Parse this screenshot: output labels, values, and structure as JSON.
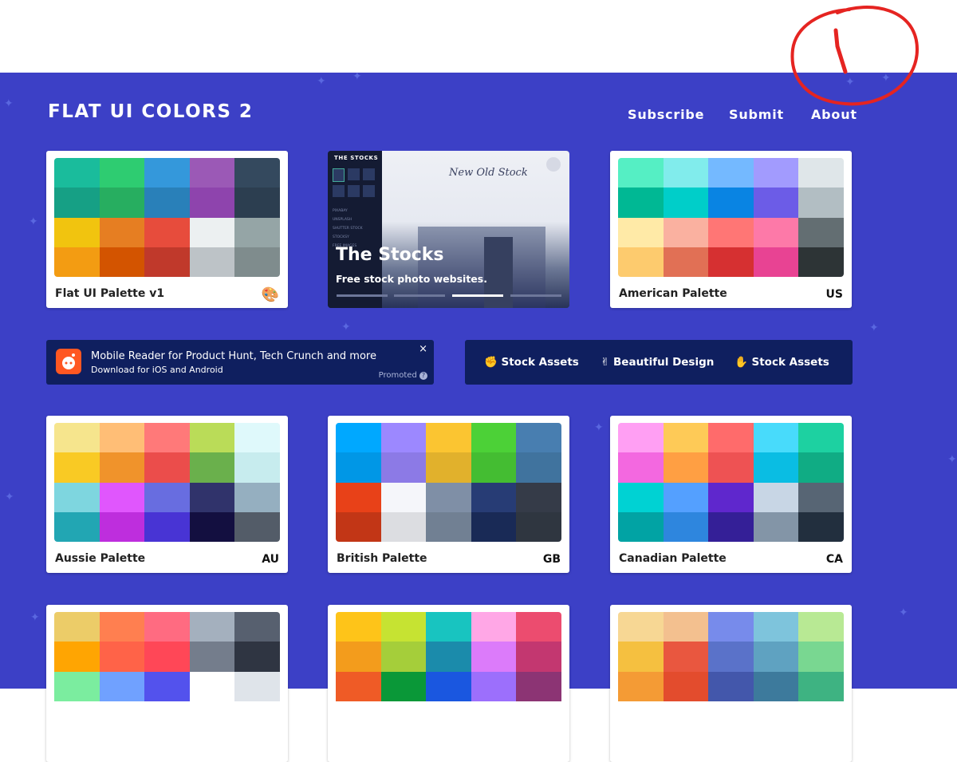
{
  "brand": {
    "title": "FLAT UI COLORS 2"
  },
  "nav": {
    "subscribe": "Subscribe",
    "submit": "Submit",
    "about": "About"
  },
  "ad": {
    "sidebar_heading": "THE STOCKS",
    "sidebar_items": [
      "PIXABAY",
      "UNSPLASH",
      "SHUTTER STOCK",
      "STOCKSY",
      "FREE IMAGES"
    ],
    "script_title": "New Old Stock",
    "title": "The Stocks",
    "subtitle": "Free stock photo websites."
  },
  "promo": {
    "title": "Mobile Reader for Product Hunt, Tech Crunch and more",
    "subtitle": "Download for iOS and Android",
    "tag": "Promoted",
    "close": "×"
  },
  "banner": {
    "item1": "✊ Stock Assets",
    "item2": "✌ Beautiful Design",
    "item3": "✋ Stock Assets"
  },
  "palettes": [
    {
      "name": "Flat UI Palette v1",
      "code": "🎨",
      "colors": [
        "#1abc9c",
        "#2ecc71",
        "#3498db",
        "#9b59b6",
        "#34495e",
        "#16a085",
        "#27ae60",
        "#2980b9",
        "#8e44ad",
        "#2c3e50",
        "#f1c40f",
        "#e67e22",
        "#e74c3c",
        "#ecf0f1",
        "#95a5a6",
        "#f39c12",
        "#d35400",
        "#c0392b",
        "#bdc3c7",
        "#7f8c8d"
      ]
    },
    {
      "name": "American Palette",
      "code": "US",
      "colors": [
        "#55efc4",
        "#81ecec",
        "#74b9ff",
        "#a29bfe",
        "#dfe6e9",
        "#00b894",
        "#00cec9",
        "#0984e3",
        "#6c5ce7",
        "#b2bec3",
        "#ffeaa7",
        "#fab1a0",
        "#ff7675",
        "#fd79a8",
        "#636e72",
        "#fdcb6e",
        "#e17055",
        "#d63031",
        "#e84393",
        "#2d3436"
      ]
    },
    {
      "name": "Aussie Palette",
      "code": "AU",
      "colors": [
        "#f6e58d",
        "#ffbe76",
        "#ff7979",
        "#badc58",
        "#dff9fb",
        "#f9ca24",
        "#f0932b",
        "#eb4d4b",
        "#6ab04c",
        "#c7ecee",
        "#7ed6df",
        "#e056fd",
        "#686de0",
        "#30336b",
        "#95afc0",
        "#22a6b3",
        "#be2edd",
        "#4834d4",
        "#130f40",
        "#535c68"
      ]
    },
    {
      "name": "British Palette",
      "code": "GB",
      "colors": [
        "#00a8ff",
        "#9c88ff",
        "#fbc531",
        "#4cd137",
        "#487eb0",
        "#0097e6",
        "#8c7ae6",
        "#e1b12c",
        "#44bd32",
        "#40739e",
        "#e84118",
        "#f5f6fa",
        "#7f8fa6",
        "#273c75",
        "#353b48",
        "#c23616",
        "#dcdde1",
        "#718093",
        "#192a56",
        "#2f3640"
      ]
    },
    {
      "name": "Canadian Palette",
      "code": "CA",
      "colors": [
        "#ff9ff3",
        "#feca57",
        "#ff6b6b",
        "#48dbfb",
        "#1dd1a1",
        "#f368e0",
        "#ff9f43",
        "#ee5253",
        "#0abde3",
        "#10ac84",
        "#00d2d3",
        "#54a0ff",
        "#5f27cd",
        "#c8d6e5",
        "#576574",
        "#01a3a4",
        "#2e86de",
        "#341f97",
        "#8395a7",
        "#222f3e"
      ]
    },
    {
      "name": "",
      "code": "",
      "colors": [
        "#eccc68",
        "#ff7f50",
        "#ff6b81",
        "#a4b0be",
        "#57606f",
        "#ffa502",
        "#ff6348",
        "#ff4757",
        "#747d8c",
        "#2f3542",
        "#7bed9f",
        "#70a1ff",
        "#5352ed",
        "#ffffff",
        "#dfe4ea"
      ]
    },
    {
      "name": "",
      "code": "",
      "colors": [
        "#fec419",
        "#c6e332",
        "#18c4c0",
        "#ffa7e6",
        "#ec4c6f",
        "#f39c1c",
        "#a5ce3a",
        "#1b8bab",
        "#dc7bfa",
        "#c33770",
        "#ef5b26",
        "#0a9838",
        "#1a57e0",
        "#9c6ffc",
        "#8c3474"
      ]
    },
    {
      "name": "",
      "code": "",
      "colors": [
        "#f7d794",
        "#f3c08f",
        "#778beb",
        "#7ec4dc",
        "#b8e994",
        "#f5c040",
        "#e9573f",
        "#5a72c9",
        "#5fa2c1",
        "#79d791",
        "#f49b35",
        "#e34c2d",
        "#4357ab",
        "#3d7a9c",
        "#3eb382"
      ]
    }
  ]
}
